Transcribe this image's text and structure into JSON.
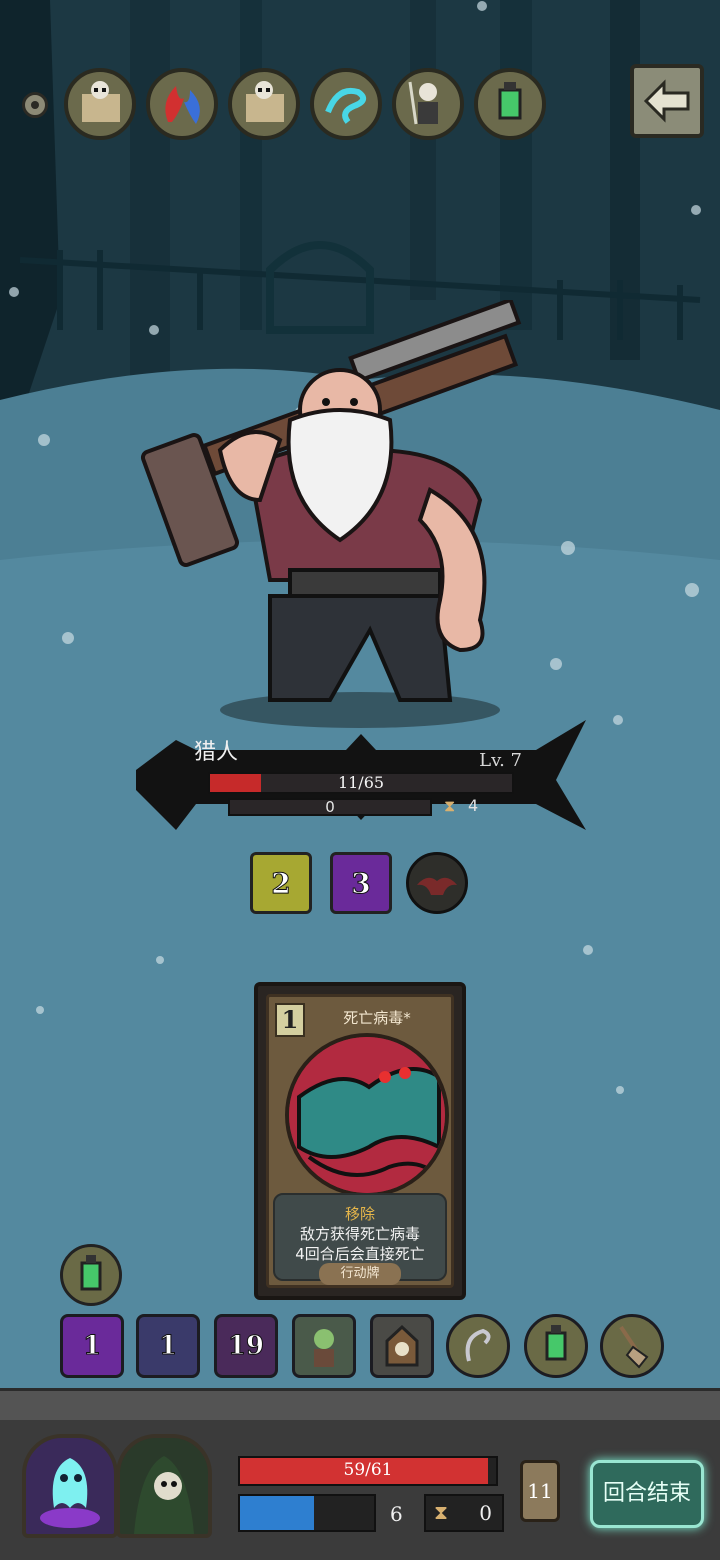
{
  "relics": [
    {
      "icon": "skeleton-scroll-icon"
    },
    {
      "icon": "red-blue-flame-icon"
    },
    {
      "icon": "skeleton-scroll-icon"
    },
    {
      "icon": "cyan-swirl-icon"
    },
    {
      "icon": "skeleton-reaper-icon"
    },
    {
      "icon": "green-lantern-icon"
    }
  ],
  "enemy": {
    "name": "猎人",
    "level": "Lv. 7",
    "hp_text": "11/65",
    "hp_current": 11,
    "hp_max": 65,
    "block": "0",
    "timer": "4"
  },
  "enemy_intents": [
    {
      "value": "2",
      "icon": "poison-stack-icon"
    },
    {
      "value": "3",
      "icon": "purple-curse-icon"
    },
    {
      "value": "",
      "icon": "bat-shadow-icon"
    }
  ],
  "card": {
    "cost": "1",
    "title": "死亡病毒*",
    "keyword": "移除",
    "line1": "敌方获得死亡病毒",
    "line2": "4回合后会直接死亡",
    "type": "行动牌"
  },
  "player_buffs": [
    {
      "value": "1",
      "icon": "purple-eye-icon"
    },
    {
      "value": "1",
      "icon": "shadow-knight-icon"
    },
    {
      "value": "19",
      "icon": "purple-claw-icon"
    },
    {
      "value": "",
      "icon": "zombie-icon"
    },
    {
      "value": "",
      "icon": "cuckoo-clock-icon"
    },
    {
      "value": "",
      "icon": "ghost-hook-icon"
    },
    {
      "value": "",
      "icon": "green-lantern-icon"
    },
    {
      "value": "",
      "icon": "shovel-icon"
    }
  ],
  "player": {
    "hp_text": "59/61",
    "hp_current": 59,
    "hp_max": 61,
    "mana": "6",
    "mana_fill": 0.55,
    "timer": "0",
    "deck_count": "11"
  },
  "end_turn_label": "回合结束",
  "colors": {
    "hp": "#c62a2a",
    "mana": "#2e7fd0",
    "end_turn_glow": "#7cf0d4"
  }
}
